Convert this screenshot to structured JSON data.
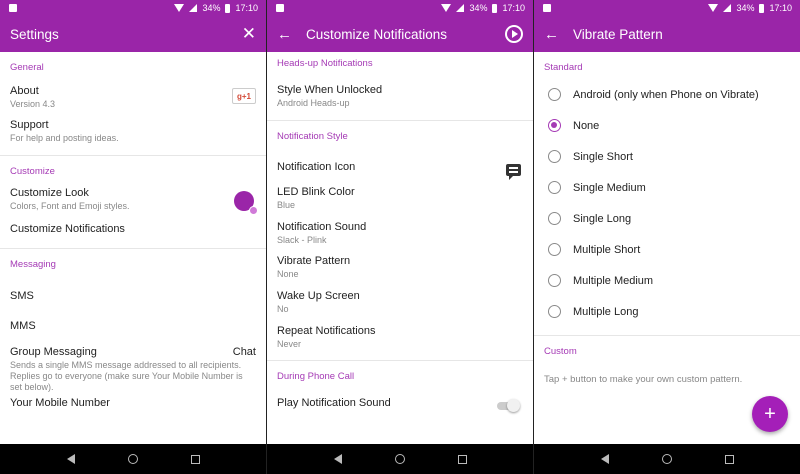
{
  "status": {
    "battery": "34%",
    "time": "17:10"
  },
  "settings": {
    "title": "Settings",
    "general_header": "General",
    "about_title": "About",
    "about_version": "Version 4.3",
    "gplus_label": "g+1",
    "support_title": "Support",
    "support_sub": "For help and posting ideas.",
    "customize_header": "Customize",
    "look_title": "Customize Look",
    "look_sub": "Colors, Font and Emoji styles.",
    "notifications_title": "Customize Notifications",
    "messaging_header": "Messaging",
    "sms": "SMS",
    "mms": "MMS",
    "group_title": "Group Messaging",
    "group_value": "Chat",
    "group_sub": "Sends a single MMS message addressed to all recipients. Replies go to everyone (make sure Your Mobile Number is set below).",
    "mobile_title": "Your Mobile Number"
  },
  "notifications": {
    "title": "Customize Notifications",
    "headsup_header": "Heads-up Notifications",
    "style_unlocked_title": "Style When Unlocked",
    "style_unlocked_value": "Android Heads-up",
    "style_header": "Notification Style",
    "icon_title": "Notification Icon",
    "led_title": "LED Blink Color",
    "led_value": "Blue",
    "sound_title": "Notification Sound",
    "sound_value": "Slack - Plink",
    "vibrate_title": "Vibrate Pattern",
    "vibrate_value": "None",
    "wake_title": "Wake Up Screen",
    "wake_value": "No",
    "repeat_title": "Repeat Notifications",
    "repeat_value": "Never",
    "call_header": "During Phone Call",
    "play_sound_title": "Play Notification Sound"
  },
  "vibrate": {
    "title": "Vibrate Pattern",
    "standard_header": "Standard",
    "options": [
      "Android (only when Phone on Vibrate)",
      "None",
      "Single Short",
      "Single Medium",
      "Single Long",
      "Multiple Short",
      "Multiple Medium",
      "Multiple Long"
    ],
    "selected_index": 1,
    "custom_header": "Custom",
    "custom_hint": "Tap + button to make your own custom pattern.",
    "fab_label": "+"
  },
  "colors": {
    "accent": "#9a25a8",
    "section": "#a53ab5"
  }
}
